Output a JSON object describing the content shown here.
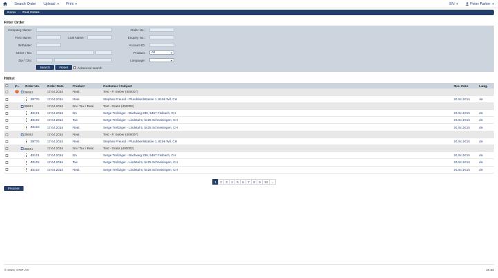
{
  "nav": {
    "items": [
      {
        "label": "Search Order",
        "caret": false
      },
      {
        "label": "Upload",
        "caret": true
      },
      {
        "label": "Print",
        "caret": true
      }
    ],
    "lang": "EN",
    "user": "Peter Parker"
  },
  "breadcrumb": {
    "home": "Home",
    "sep": "›",
    "current": "Real Estate"
  },
  "filter": {
    "title": "Filter Order",
    "company_label": "Company Name:",
    "firstname_label": "First Name:",
    "lastname_label": "Last Name:",
    "birthdate_label": "Birthdate:",
    "street_label": "Street / No:",
    "zip_label": "Zip / City:",
    "orderno_label": "Order No.:",
    "enquiry_label": "Enquiry No.:",
    "account_label": "Account ID:",
    "product_label": "Product:",
    "product_value": "All",
    "language_label": "Language:",
    "language_value": "",
    "search_label": "Search",
    "reset_label": "Reset",
    "advanced_label": "Advanced search"
  },
  "hitlist": {
    "title": "Hitlist",
    "columns": {
      "p": "P...",
      "order_no": "Order No.",
      "order_date": "Order Date",
      "product": "Product",
      "customer": "Customer / Subject",
      "res_date": "Res. Date",
      "lang": "Lang."
    },
    "rows": [
      {
        "order_no": "39363",
        "order_date": "17.04.2014",
        "product": "Real.",
        "customer": "Test - P. Sieber (400007)",
        "res_date": "",
        "lang": ""
      },
      {
        "order_no": "39776",
        "order_date": "17.04.2014",
        "product": "Real.",
        "customer": "Stephan Freund - Pfundskerlstrasse 1, 8196 Wil, CH",
        "res_date": "20.04.2014",
        "lang": "de"
      },
      {
        "order_no": "39401",
        "order_date": "17.04.2014",
        "product": "BA / Tax / Real.",
        "customer": "Test - Gratis (400002)",
        "res_date": "",
        "lang": ""
      },
      {
        "order_no": "40101",
        "order_date": "17.04.2014",
        "product": "BA",
        "customer": "Serge Treßziger - Bachweg 236, 5467 Fisibach, CH",
        "res_date": "20.04.2014",
        "lang": "de"
      },
      {
        "order_no": "40102",
        "order_date": "17.04.2014",
        "product": "Tax",
        "customer": "Serge Treßziger - Lindetal 5, 5425 Schneisingen, CH",
        "res_date": "20.04.2014",
        "lang": "de"
      },
      {
        "order_no": "40103",
        "order_date": "17.04.2014",
        "product": "Real.",
        "customer": "Serge Treßziger - Lindetal 5, 5425 Schneisingen, CH",
        "res_date": "20.04.2014",
        "lang": "de"
      },
      {
        "order_no": "39363",
        "order_date": "17.04.2014",
        "product": "Real.",
        "customer": "Test - P. Sieber (400007)",
        "res_date": "",
        "lang": ""
      },
      {
        "order_no": "39776",
        "order_date": "17.04.2014",
        "product": "Real.",
        "customer": "Stephan Freund - Pfundskerlstrasse 1, 8196 Wil, CH",
        "res_date": "20.04.2014",
        "lang": "de"
      },
      {
        "order_no": "39401",
        "order_date": "17.04.2014",
        "product": "BA / Tax / Real.",
        "customer": "Test - Gratis (400002)",
        "res_date": "",
        "lang": ""
      },
      {
        "order_no": "40101",
        "order_date": "17.04.2014",
        "product": "BA",
        "customer": "Serge Treßziger - Bachweg 236, 5467 Fisibach, CH",
        "res_date": "20.04.2014",
        "lang": "de"
      },
      {
        "order_no": "40102",
        "order_date": "17.04.2014",
        "product": "Tax",
        "customer": "Serge Treßziger - Lindetal 5, 5425 Schneisingen, CH",
        "res_date": "20.04.2014",
        "lang": "de"
      },
      {
        "order_no": "40103",
        "order_date": "17.04.2014",
        "product": "Real.",
        "customer": "Serge Treßziger - Lindetal 5, 5425 Schneisingen, CH",
        "res_date": "20.04.2014",
        "lang": "de"
      }
    ]
  },
  "pagination": {
    "pages": [
      "1",
      "2",
      "3",
      "4",
      "5",
      "6",
      "7",
      "8",
      "9",
      "10"
    ],
    "next": "→",
    "active": "1"
  },
  "process_label": "Process",
  "footer": {
    "copyright": "© 2023, CRIF AG",
    "version": "v9.36"
  },
  "colors": {
    "primary": "#233f69",
    "panel": "#ccd5de",
    "alert": "#e4612b"
  }
}
